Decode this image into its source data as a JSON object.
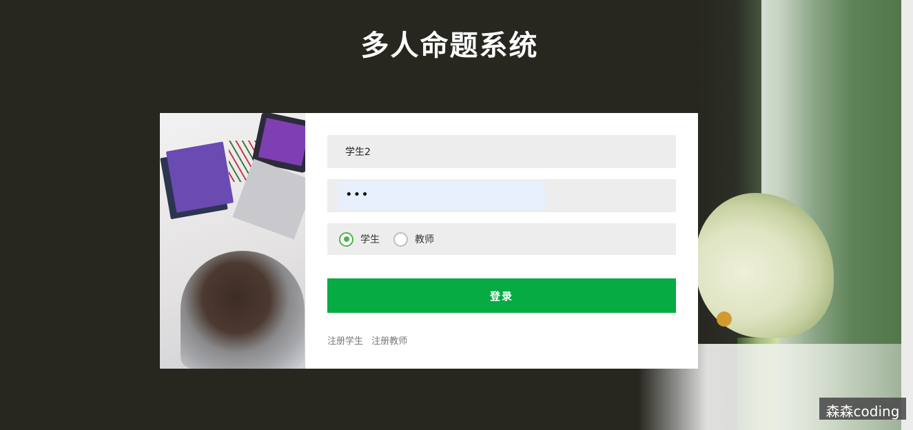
{
  "page": {
    "title": "多人命题系统"
  },
  "login_form": {
    "username_value": "学生2",
    "password_masked": "•••",
    "role_options": [
      {
        "label": "学生",
        "selected": true
      },
      {
        "label": "教师",
        "selected": false
      }
    ],
    "login_label": "登录",
    "links": [
      {
        "label": "注册学生"
      },
      {
        "label": "注册教师"
      }
    ]
  },
  "watermark": {
    "text": "森森coding"
  },
  "colors": {
    "background": "#27261f",
    "primary_button": "#07ab44",
    "radio_checked": "#4fb34f",
    "field_background": "#ededed"
  }
}
